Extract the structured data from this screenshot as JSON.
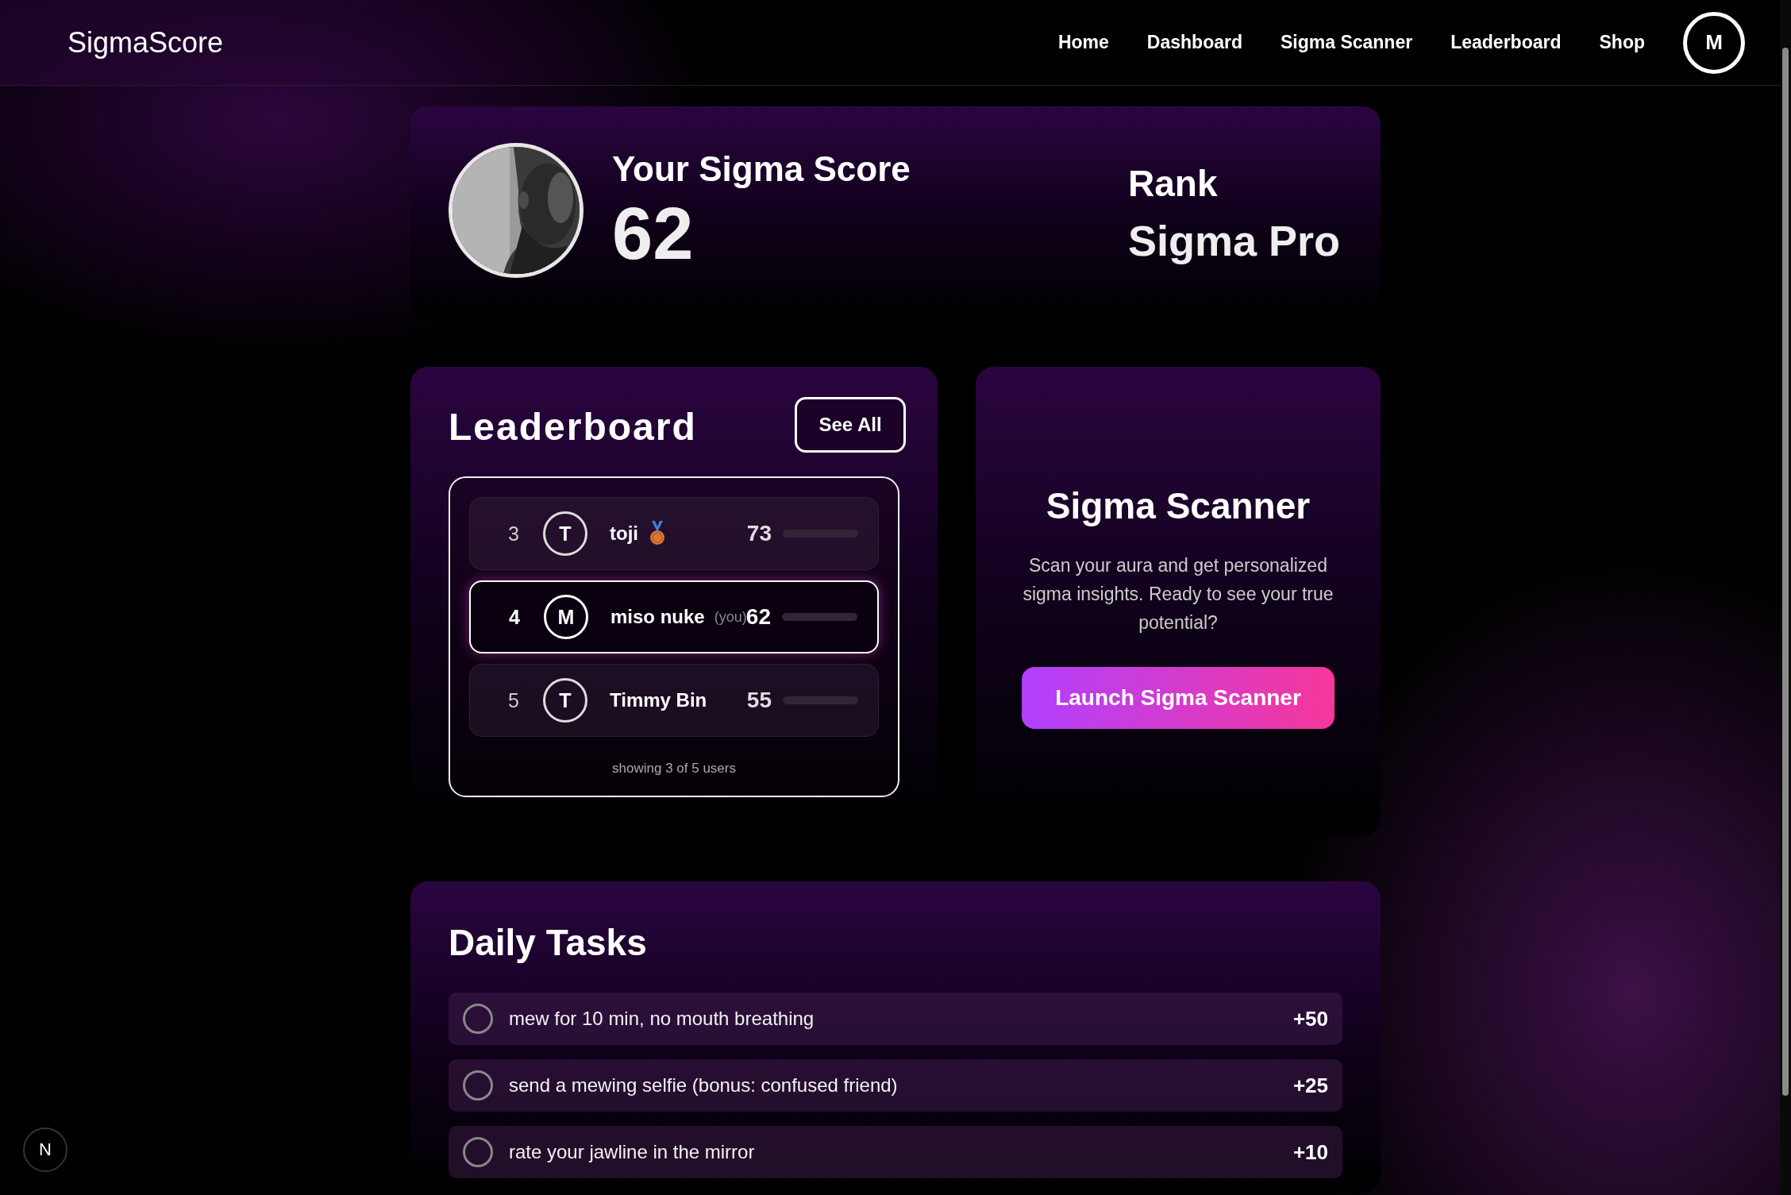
{
  "navbar": {
    "brand": "SigmaScore",
    "links": [
      {
        "label": "Home"
      },
      {
        "label": "Dashboard"
      },
      {
        "label": "Sigma Scanner"
      },
      {
        "label": "Leaderboard"
      },
      {
        "label": "Shop"
      }
    ],
    "avatar": "M"
  },
  "score_card": {
    "title": "Your Sigma Score",
    "score": "62",
    "rank_label": "Rank",
    "rank": "Sigma Pro"
  },
  "leaderboard": {
    "title": "Leaderboard",
    "button": "See All",
    "rows": [
      {
        "rank": "3",
        "initial": "T",
        "name": "toji",
        "medal": true,
        "score": "73",
        "selected": false
      },
      {
        "rank": "4",
        "initial": "M",
        "name": "miso nuke",
        "tag": "(you)",
        "medal": false,
        "score": "62",
        "selected": true
      },
      {
        "rank": "5",
        "initial": "T",
        "name": "Timmy Bin",
        "medal": false,
        "score": "55",
        "selected": false
      }
    ],
    "footer": "showing 3 of 5 users"
  },
  "scanner": {
    "title": "Sigma Scanner",
    "text": "Scan your aura and get personalized sigma insights. Ready to see your true potential?",
    "button": "Launch Sigma Scanner"
  },
  "daily_tasks": {
    "title": "Daily Tasks",
    "tasks": [
      {
        "label": "mew for 10 min, no mouth breathing",
        "points": "+50",
        "checked": false
      },
      {
        "label": "send a mewing selfie (bonus: confused friend)",
        "points": "+25",
        "checked": false
      },
      {
        "label": "rate your jawline in the mirror",
        "points": "+10",
        "checked": false
      }
    ]
  },
  "dev_badge": "N"
}
